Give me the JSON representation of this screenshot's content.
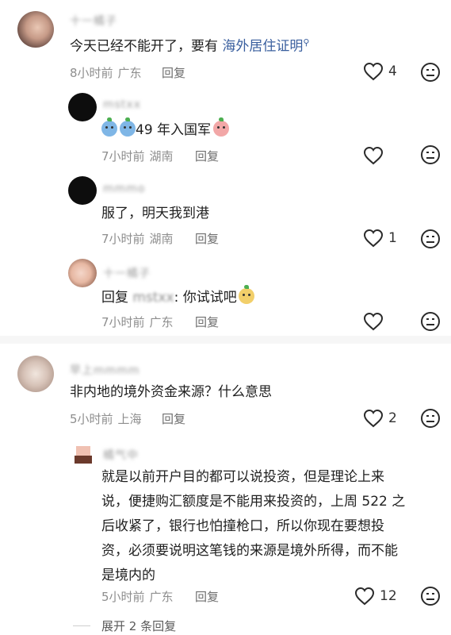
{
  "comments": [
    {
      "username": "十一橘子",
      "text_before": "今天已经不能开了，要有 ",
      "link": "海外居住证明",
      "time": "8小时前",
      "location": "广东",
      "reply_label": "回复",
      "likes": "4"
    },
    {
      "username": "mstxx",
      "text": "49 年入国军",
      "time": "7小时前",
      "location": "湖南",
      "reply_label": "回复",
      "likes": ""
    },
    {
      "username": "mmmo",
      "text": "服了，明天我到港",
      "time": "7小时前",
      "location": "湖南",
      "reply_label": "回复",
      "likes": "1"
    },
    {
      "username": "十一橘子",
      "reply_prefix": "回复",
      "mention": "mstxx",
      "text": ": 你试试吧",
      "time": "7小时前",
      "location": "广东",
      "reply_label": "回复",
      "likes": ""
    },
    {
      "username": "早上mmmm",
      "text": "非内地的境外资金来源？什么意思",
      "time": "5小时前",
      "location": "上海",
      "reply_label": "回复",
      "likes": "2"
    },
    {
      "username": "橘气中",
      "text_lines": [
        "就是以前开户目的都可以说投资，但是理论上来",
        "说，便捷购汇额度是不能用来投资的，上周 522 之",
        "后收紧了，银行也怕撞枪口，所以你现在要想投",
        "资，必须要说明这笔钱的来源是境外所得，而不能",
        "是境内的"
      ],
      "time": "5小时前",
      "location": "广东",
      "reply_label": "回复",
      "likes": "12"
    }
  ],
  "expand_label": "展开 2 条回复",
  "icons": {
    "like": "heart-outline-icon",
    "dislike": "sad-face-icon"
  }
}
